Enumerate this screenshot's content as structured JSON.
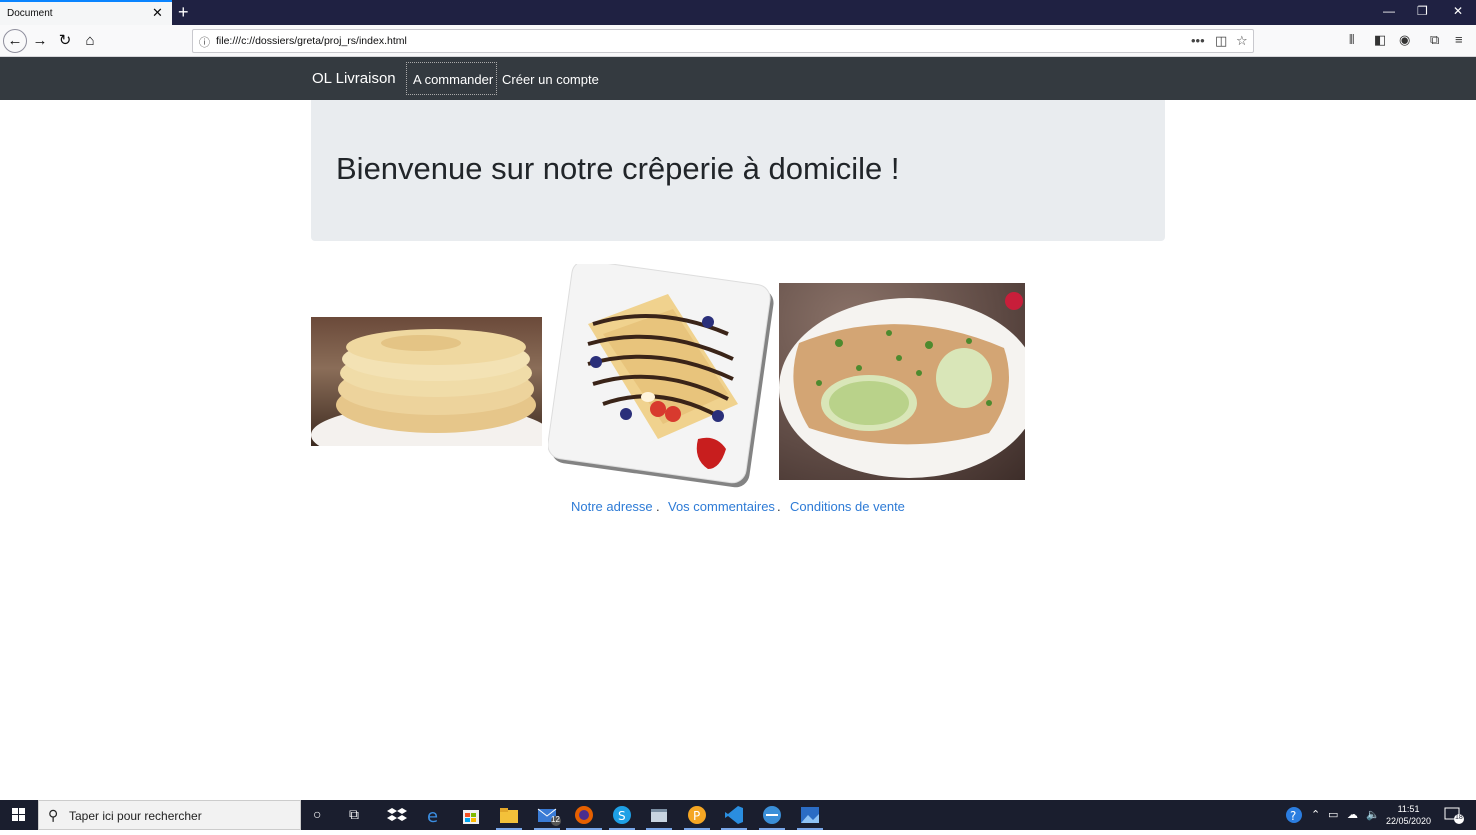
{
  "browser": {
    "tab_title": "Document",
    "tab_close": "✕",
    "new_tab": "+",
    "url": "file:///c://dossiers/greta/proj_rs/index.html",
    "window_controls": [
      "—",
      "❐",
      "✕"
    ]
  },
  "site": {
    "brand": "OL Livraison",
    "nav": [
      "A commander",
      "Créer un compte"
    ],
    "hero_title": "Bienvenue sur notre crêperie à domicile !",
    "images": [
      "stack-of-crepes",
      "crepe-with-chocolate-and-fruit",
      "savory-crepe-with-herbs"
    ],
    "footer_links": [
      "Notre adresse",
      "Vos commentaires",
      "Conditions de vente"
    ],
    "footer_sep": "."
  },
  "taskbar": {
    "search_placeholder": "Taper ici pour rechercher",
    "mail_badge": "12",
    "time": "11:51",
    "date": "22/05/2020",
    "notifications_count": "18"
  },
  "colors": {
    "tab_strip": "#1f2142",
    "site_navbar": "#343a40",
    "jumbotron": "#e9ecef",
    "link": "#2e7bd6",
    "taskbar": "#1a1e2e"
  }
}
